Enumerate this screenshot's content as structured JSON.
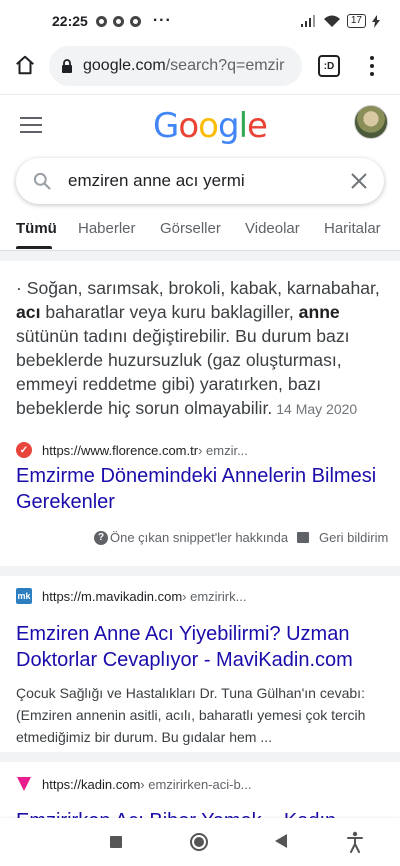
{
  "status_bar": {
    "time": "22:25",
    "more": "···",
    "battery": "17"
  },
  "browser": {
    "url_host": "google.com",
    "url_rest": "/search?q=emzir",
    "tab_switcher": ":D"
  },
  "google": {
    "logo": [
      "G",
      "o",
      "o",
      "g",
      "l",
      "e"
    ],
    "logo_colors": [
      "#4285F4",
      "#EA4335",
      "#FBBC05",
      "#4285F4",
      "#34A853",
      "#EA4335"
    ],
    "query": "emziren anne acı yermi"
  },
  "tabs": [
    {
      "label": "Tümü",
      "active": true
    },
    {
      "label": "Haberler"
    },
    {
      "label": "Görseller"
    },
    {
      "label": "Videolar"
    },
    {
      "label": "Haritalar"
    }
  ],
  "featured_snippet": {
    "lead": "· Soğan, sarımsak, brokoli, kabak, karnabahar, ",
    "bold1": "acı",
    "mid": " baharatlar veya kuru baklagiller, ",
    "bold2": "anne",
    "tail": " sütünün tadını değiştirebilir. Bu durum bazı bebeklerde huzursuzluk (gaz oluşturması, emmeyi reddetme gibi) yaratırken, bazı bebeklerde hiç sorun olmayabilir.",
    "date": "14 May 2020",
    "site": "https://www.florence.com.tr",
    "site_path": " › emzir...",
    "title": "Emzirme Dönemindeki Annelerin Bilmesi Gerekenler",
    "about_label": "Öne çıkan snippet'ler hakkında",
    "feedback_label": "Geri bildirim"
  },
  "results": [
    {
      "site": "https://m.mavikadin.com",
      "site_path": " › emzirirk...",
      "favicon_text": "mk",
      "title": "Emziren Anne Acı Yiyebilirmi? Uzman Doktorlar Cevaplıyor - MaviKadin.com",
      "description": "Çocuk Sağlığı ve Hastalıkları Dr. Tuna Gülhan'ın cevabı: (Emziren annenin asitli, acılı, baharatlı yemesi çok tercih etmediğimiz bir durum. Bu gıdalar hem ..."
    },
    {
      "site": "https://kadin.com",
      "site_path": " › emzirirken-aci-b...",
      "title": "Emzirirken Acı Biber Yemek – Kadın"
    }
  ]
}
